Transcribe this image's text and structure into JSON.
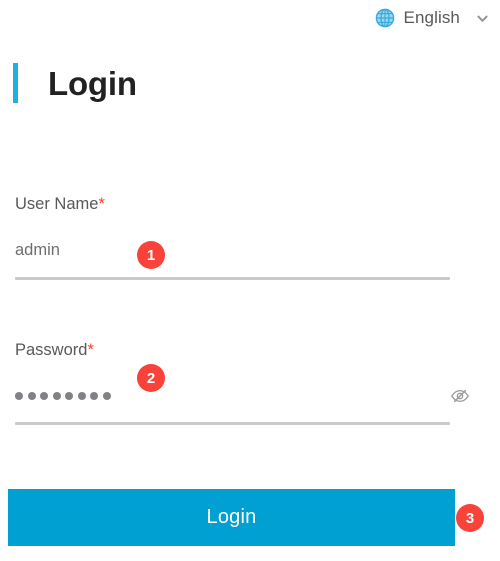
{
  "language_selector": {
    "icon": "globe-icon",
    "label": "English",
    "chevron": "chevron-down-icon"
  },
  "page": {
    "title": "Login",
    "accent_color": "#1fb0e2"
  },
  "form": {
    "username": {
      "label": "User Name",
      "required_marker": "*",
      "value": "admin",
      "placeholder": "User Name"
    },
    "password": {
      "label": "Password",
      "required_marker": "*",
      "value": "••••••••",
      "masked_char_count": 8,
      "placeholder": "Password",
      "toggle_icon": "eye-slash-icon"
    }
  },
  "submit": {
    "label": "Login",
    "color": "#00a0d2"
  },
  "callouts": {
    "badge_color": "#f9423a",
    "items": [
      {
        "number": "1"
      },
      {
        "number": "2"
      },
      {
        "number": "3"
      }
    ]
  }
}
